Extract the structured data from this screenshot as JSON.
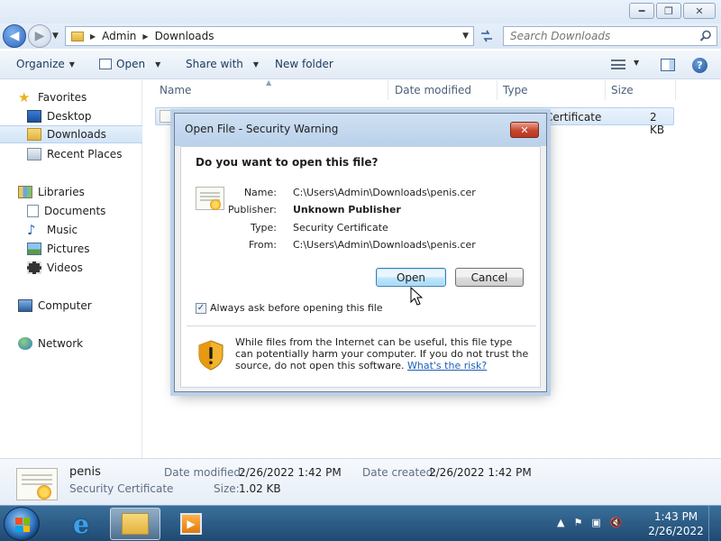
{
  "window": {
    "minimize": "━",
    "maximize": "❐",
    "close": "✕"
  },
  "address": {
    "crumbs": [
      "Admin",
      "Downloads"
    ],
    "search_placeholder": "Search Downloads"
  },
  "toolbar": {
    "organize": "Organize",
    "open": "Open",
    "share_with": "Share with",
    "new_folder": "New folder"
  },
  "nav": {
    "favorites": "Favorites",
    "desktop": "Desktop",
    "downloads": "Downloads",
    "recent_places": "Recent Places",
    "libraries": "Libraries",
    "documents": "Documents",
    "music": "Music",
    "pictures": "Pictures",
    "videos": "Videos",
    "computer": "Computer",
    "network": "Network"
  },
  "columns": {
    "name": "Name",
    "date_modified": "Date modified",
    "type": "Type",
    "size": "Size"
  },
  "file": {
    "type_partial": "Certificate",
    "size": "2 KB"
  },
  "details": {
    "name": "penis",
    "type": "Security Certificate",
    "date_modified_label": "Date modified:",
    "date_modified": "2/26/2022 1:42 PM",
    "size_label": "Size:",
    "size": "1.02 KB",
    "date_created_label": "Date created:",
    "date_created": "2/26/2022 1:42 PM"
  },
  "dialog": {
    "title": "Open File - Security Warning",
    "close": "✕",
    "question": "Do you want to open this file?",
    "name_label": "Name:",
    "name": "C:\\Users\\Admin\\Downloads\\penis.cer",
    "publisher_label": "Publisher:",
    "publisher": "Unknown Publisher",
    "type_label": "Type:",
    "type": "Security Certificate",
    "from_label": "From:",
    "from": "C:\\Users\\Admin\\Downloads\\penis.cer",
    "open_button": "Open",
    "cancel_button": "Cancel",
    "always_ask": "Always ask before opening this file",
    "always_ask_checked": "✓",
    "warning": "While files from the Internet can be useful, this file type can potentially harm your computer. If you do not trust the source, do not open this software.",
    "risk_link": "What's the risk?"
  },
  "taskbar": {
    "time": "1:43 PM",
    "date": "2/26/2022"
  },
  "colors": {
    "accent": "#1a5fb4",
    "title_bar": "#b9d1ea",
    "taskbar": "#1f4a72"
  }
}
